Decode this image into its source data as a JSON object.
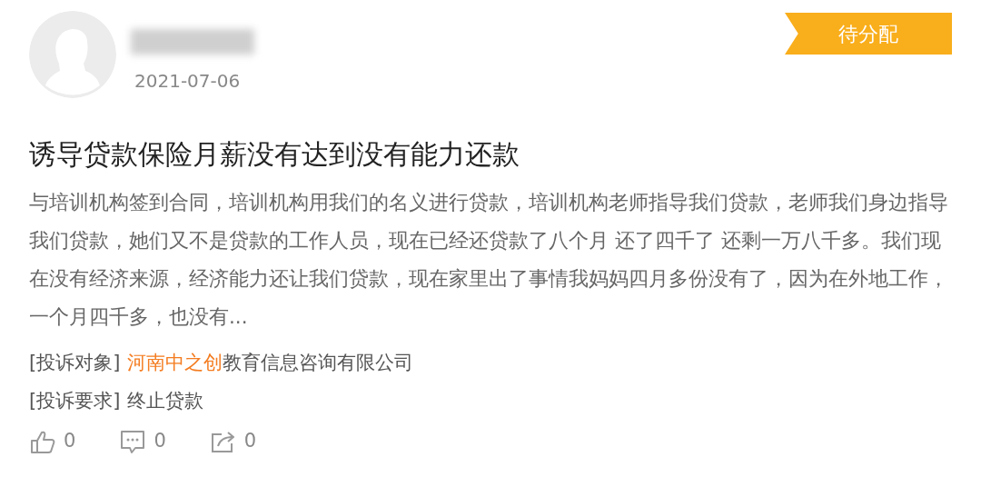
{
  "author": {
    "date": "2021-07-06"
  },
  "status_badge": {
    "label": "待分配"
  },
  "title": "诱导贷款保险月薪没有达到没有能力还款",
  "body": "与培训机构签到合同，培训机构用我们的名义进行贷款，培训机构老师指导我们贷款，老师我们身边指导我们贷款，她们又不是贷款的工作人员，现在已经还贷款了八个月 还了四千了 还剩一万八千多。我们现在没有经济来源，经济能力还让我们贷款，现在家里出了事情我妈妈四月多份没有了，因为在外地工作，一个月四千多，也没有...",
  "details": [
    {
      "label": "[投诉对象]",
      "highlight": "河南中之创",
      "value": "教育信息咨询有限公司"
    },
    {
      "label": "[投诉要求]",
      "value": "终止贷款"
    }
  ],
  "actions": [
    {
      "kind": "like",
      "count": "0"
    },
    {
      "kind": "comment",
      "count": "0"
    },
    {
      "kind": "share",
      "count": "0"
    }
  ]
}
